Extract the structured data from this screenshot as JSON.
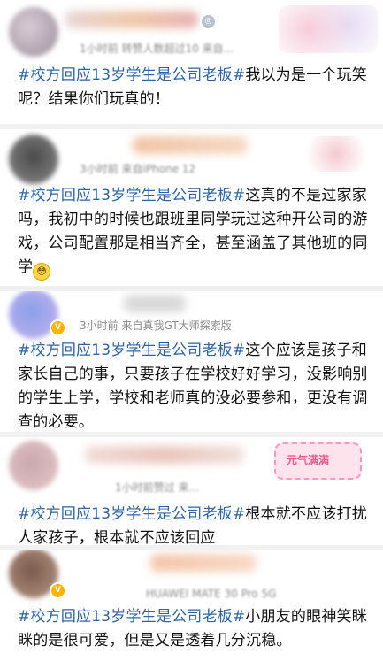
{
  "posts": [
    {
      "meta": "1小时前  转赞人数超过10   来自...",
      "hashtag": "#校方回应13岁学生是公司老板#",
      "text": "我以为是一个玩笑呢？结果你们玩真的！"
    },
    {
      "meta": "3小时前   来自iPhone 12",
      "hashtag": "#校方回应13岁学生是公司老板#",
      "text": "这真的不是过家家吗，我初中的时候也跟班里同学玩过这种开公司的游戏，公司配置那是相当齐全，甚至涵盖了其他班的同学",
      "emoji": "😳"
    },
    {
      "meta": "3小时前   来自真我GT大师探索版",
      "hashtag": "#校方回应13岁学生是公司老板#",
      "text": "这个应该是孩子和家长自己的事，只要孩子在学校好好学习，没影响别的学生上学，学校和老师真的没必要参和，更没有调查的必要。"
    },
    {
      "meta": "1小时前赞过  来...",
      "hashtag": "#校方回应13岁学生是公司老板#",
      "text": "根本就不应该打扰人家孩子，根本就不应该回应",
      "sticker": "元气满满"
    },
    {
      "meta": "HUAWEI MATE 30 Pro 5G",
      "hashtag": "#校方回应13岁学生是公司老板#",
      "text": "小朋友的眼神笑眯眯的是很可爱，但是又是透着几分沉稳。"
    }
  ],
  "colors": {
    "hashtag": "#2d63a8",
    "text": "#111111",
    "meta": "#8a8a8a",
    "vip_badge": "#ffb400"
  },
  "icons": [
    "avatar",
    "vip-badge-icon",
    "emoji-icon",
    "sticker-decoration"
  ]
}
